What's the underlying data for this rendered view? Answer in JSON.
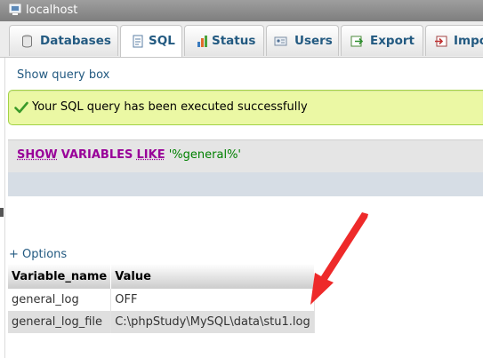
{
  "server_bar": {
    "label": "localhost",
    "icon": "server-icon"
  },
  "tabs": [
    {
      "label": "Databases",
      "icon": "databases-icon",
      "active": false
    },
    {
      "label": "SQL",
      "icon": "sql-icon",
      "active": true
    },
    {
      "label": "Status",
      "icon": "status-icon",
      "active": false
    },
    {
      "label": "Users",
      "icon": "users-icon",
      "active": false
    },
    {
      "label": "Export",
      "icon": "export-icon",
      "active": false
    },
    {
      "label": "Impo",
      "icon": "import-icon",
      "active": false
    }
  ],
  "show_query_link": "Show query box",
  "success_message": "Your SQL query has been executed successfully",
  "query": {
    "kw1": "SHOW",
    "kw2": "VARIABLES",
    "kw3": "LIKE",
    "value": "'%general%'"
  },
  "options_link": "+ Options",
  "results": {
    "columns": [
      "Variable_name",
      "Value"
    ],
    "rows": [
      [
        "general_log",
        "OFF"
      ],
      [
        "general_log_file",
        "C:\\phpStudy\\MySQL\\data\\stu1.log"
      ]
    ]
  },
  "colors": {
    "link": "#235a81",
    "success_bg": "#ebf8a4",
    "keyword": "#990099",
    "string": "#008000",
    "arrow": "#ee2a2a"
  }
}
